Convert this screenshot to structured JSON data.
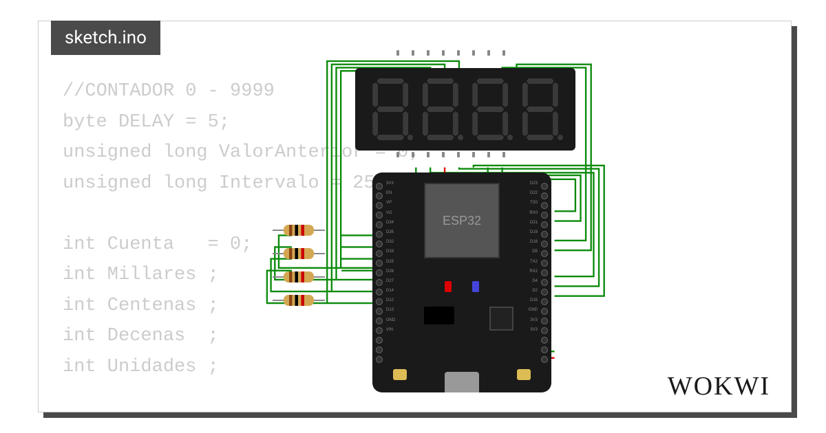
{
  "tab_title": "sketch.ino",
  "code_lines": [
    "//CONTADOR 0 - 9999",
    "byte DELAY = 5;",
    "unsigned long ValorAnterior = 0;",
    "unsigned long Intervalo = 25;",
    "",
    "int Cuenta   = 0;",
    "int Millares ;",
    "int Centenas ;",
    "int Decenas  ;",
    "int Unidades ;"
  ],
  "chip_label": "ESP32",
  "logo_text": "WOKWI",
  "components": {
    "display": "4-digit 7-segment",
    "board": "ESP32 DevKit",
    "resistor_count": 4
  },
  "pin_labels_left": [
    "3V3",
    "EN",
    "VP",
    "VO",
    "D34",
    "D35",
    "D32",
    "D33",
    "D25",
    "D26",
    "D27",
    "D14",
    "D12",
    "D13",
    "GND",
    "VIN"
  ],
  "pin_labels_right": [
    "D23",
    "D22",
    "TX0",
    "RX0",
    "D21",
    "D19",
    "D18",
    "D5",
    "TX2",
    "RX2",
    "D4",
    "D2",
    "D15",
    "GND",
    "3V3",
    "3V3"
  ],
  "wires": {
    "green": [
      "M 200,10 L 200,0 L 85,0 L 85,302 L 158,302",
      "M 222,10 L 222,-5 L 78,-5 L 78,320 L 158,320",
      "M 244,10 L 244,-10 L 71,-10 L 71,338 L 158,338",
      "M 266,10 L 266,-15 L 64,-15 L 64,356 L 158,356",
      "M 332,10 L 332,-5 L 460,-5 L 460,260 L 412,260",
      "M 354,10 L 354,-10 L 468,-10 L 468,275 L 412,275",
      "M 200,148 L 200,162 L 300,162 L 300,430 L 412,430",
      "M 222,148 L 222,156 L 472,156 L 472,315 L 412,315",
      "M 266,148 L 266,150 L 480,150 L 480,330 L 412,330",
      "M 288,148 L 288,145 L 488,145 L 488,345 L 412,345",
      "M 310,148 L 310,160 L 452,160 L 452,230 L 412,230",
      "M 332,148 L 332,166 L 444,166 L 444,215 L 412,215",
      "M 86,252 L 158,252",
      "M 86,270 L 150,270 L 150,267 L 158,267",
      "M 86,288 L 145,288 L 145,282 L 158,282",
      "M 86,306 L 140,306 L 140,297 L 158,297",
      "M 10,252 L -10,252 L -10,302 L 85,302",
      "M 10,270 L -16,270 L -16,320 L 78,320",
      "M 10,288 L -22,288 L -22,338 L 71,338",
      "M 10,306 L -28,306 L -28,356 L 64,356"
    ],
    "red": [
      "M 244,148 L 244,175 L 395,175 L 395,440 L 412,440"
    ]
  }
}
